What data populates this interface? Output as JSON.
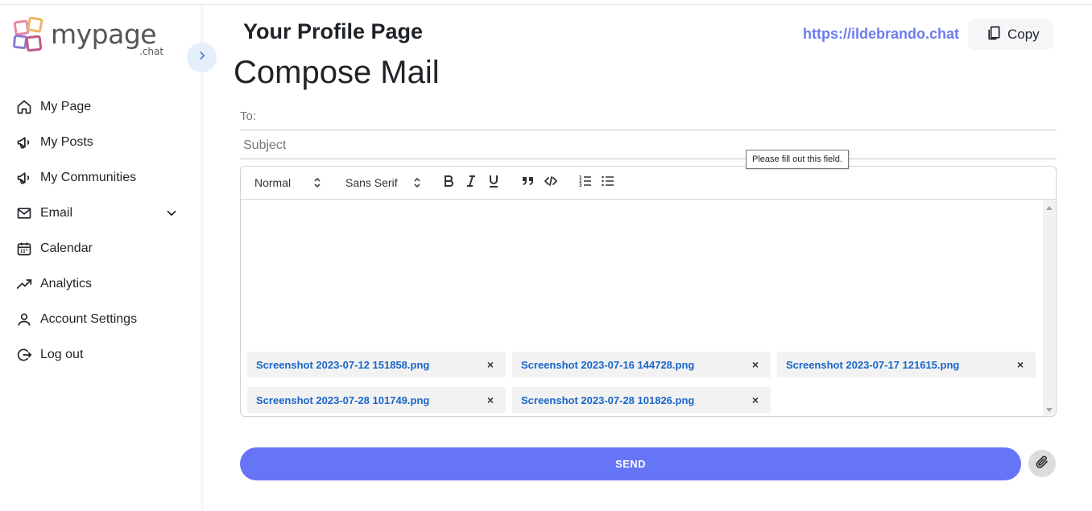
{
  "brand": {
    "name": "mypage",
    "suffix": ".chat",
    "logo_colors": [
      "#e58aa0",
      "#f0b465",
      "#8f79d6",
      "#c05a8a"
    ]
  },
  "sidebar": {
    "items": [
      {
        "label": "My Page",
        "icon": "home-icon"
      },
      {
        "label": "My Posts",
        "icon": "megaphone-icon"
      },
      {
        "label": "My Communities",
        "icon": "megaphone-icon"
      },
      {
        "label": "Email",
        "icon": "mail-icon",
        "expandable": true
      },
      {
        "label": "Calendar",
        "icon": "calendar-icon"
      },
      {
        "label": "Analytics",
        "icon": "trending-up-icon"
      },
      {
        "label": "Account Settings",
        "icon": "user-icon"
      },
      {
        "label": "Log out",
        "icon": "logout-icon"
      }
    ]
  },
  "header": {
    "title": "Your Profile Page",
    "link": "https://ildebrando.chat",
    "copy_label": "Copy"
  },
  "compose": {
    "title": "Compose Mail",
    "to_label": "To:",
    "to_value": "",
    "subject_placeholder": "Subject",
    "tooltip": "Please fill out this field.",
    "toolbar": {
      "heading_select": "Normal",
      "font_select": "Sans Serif",
      "buttons": [
        "bold",
        "italic",
        "underline",
        "blockquote",
        "code-block",
        "ordered-list",
        "bullet-list"
      ]
    },
    "attachments": [
      "Screenshot 2023-07-12 151858.png",
      "Screenshot 2023-07-16 144728.png",
      "Screenshot 2023-07-17 121615.png",
      "Screenshot 2023-07-28 101749.png",
      "Screenshot 2023-07-28 101826.png"
    ],
    "remove_symbol": "×",
    "send_label": "SEND"
  },
  "colors": {
    "accent": "#6675f8",
    "link": "#6b7cf0",
    "attachment_link": "#1a66c9",
    "collapse_bg": "#e6eefc"
  }
}
